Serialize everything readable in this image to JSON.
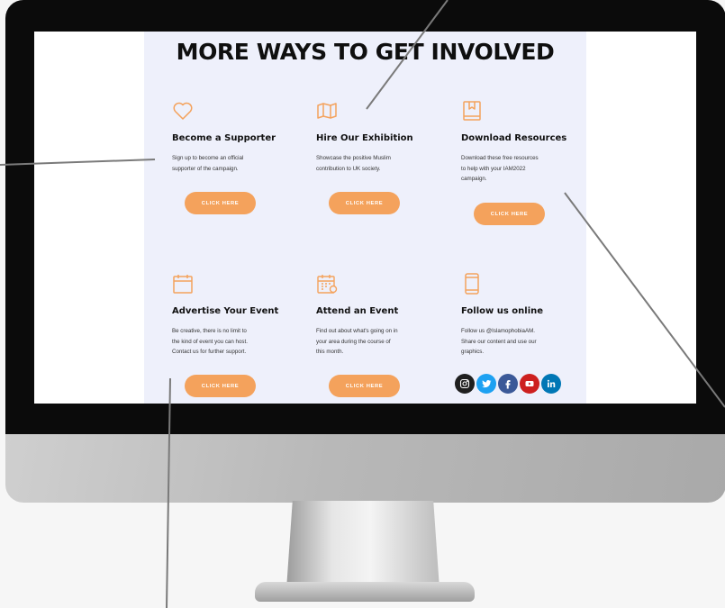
{
  "page": {
    "heading": "MORE WAYS TO GET INVOLVED"
  },
  "colors": {
    "accent": "#f4a25c",
    "panel_background": "#eef0fb",
    "heading": "#0f0f0f"
  },
  "cards": [
    {
      "icon": "heart-icon",
      "title": "Become a Supporter",
      "desc": [
        "Sign up to become an official",
        "supporter of the campaign."
      ],
      "button": "CLICK HERE"
    },
    {
      "icon": "map-icon",
      "title": "Hire Our Exhibition",
      "desc": [
        "Showcase the positive Muslim",
        "contribution to UK society."
      ],
      "button": "CLICK HERE"
    },
    {
      "icon": "book-icon",
      "title": "Download Resources",
      "desc": [
        "Download these free resources",
        "to help with your IAM2022",
        "campaign."
      ],
      "button": "CLICK HERE"
    },
    {
      "icon": "calendar-icon",
      "title": "Advertise Your Event",
      "desc": [
        "Be creative, there is no limit to",
        "the kind of event you can host.",
        "Contact us for further support."
      ],
      "button": "CLICK HERE"
    },
    {
      "icon": "event-calendar-icon",
      "title": "Attend an Event",
      "desc": [
        "Find out about what's going on in",
        "your area during the course of",
        "this month."
      ],
      "button": "CLICK HERE"
    },
    {
      "icon": "phone-icon",
      "title": "Follow us online",
      "desc": [
        "Follow us @IslamophobiaAM.",
        "Share our content and use our",
        "graphics."
      ]
    }
  ],
  "socials": [
    {
      "icon": "instagram-icon",
      "color": "#1f1f1f"
    },
    {
      "icon": "twitter-icon",
      "color": "#1da1f2"
    },
    {
      "icon": "facebook-icon",
      "color": "#3b5998"
    },
    {
      "icon": "youtube-icon",
      "color": "#cd201f"
    },
    {
      "icon": "linkedin-icon",
      "color": "#0077b5"
    }
  ]
}
